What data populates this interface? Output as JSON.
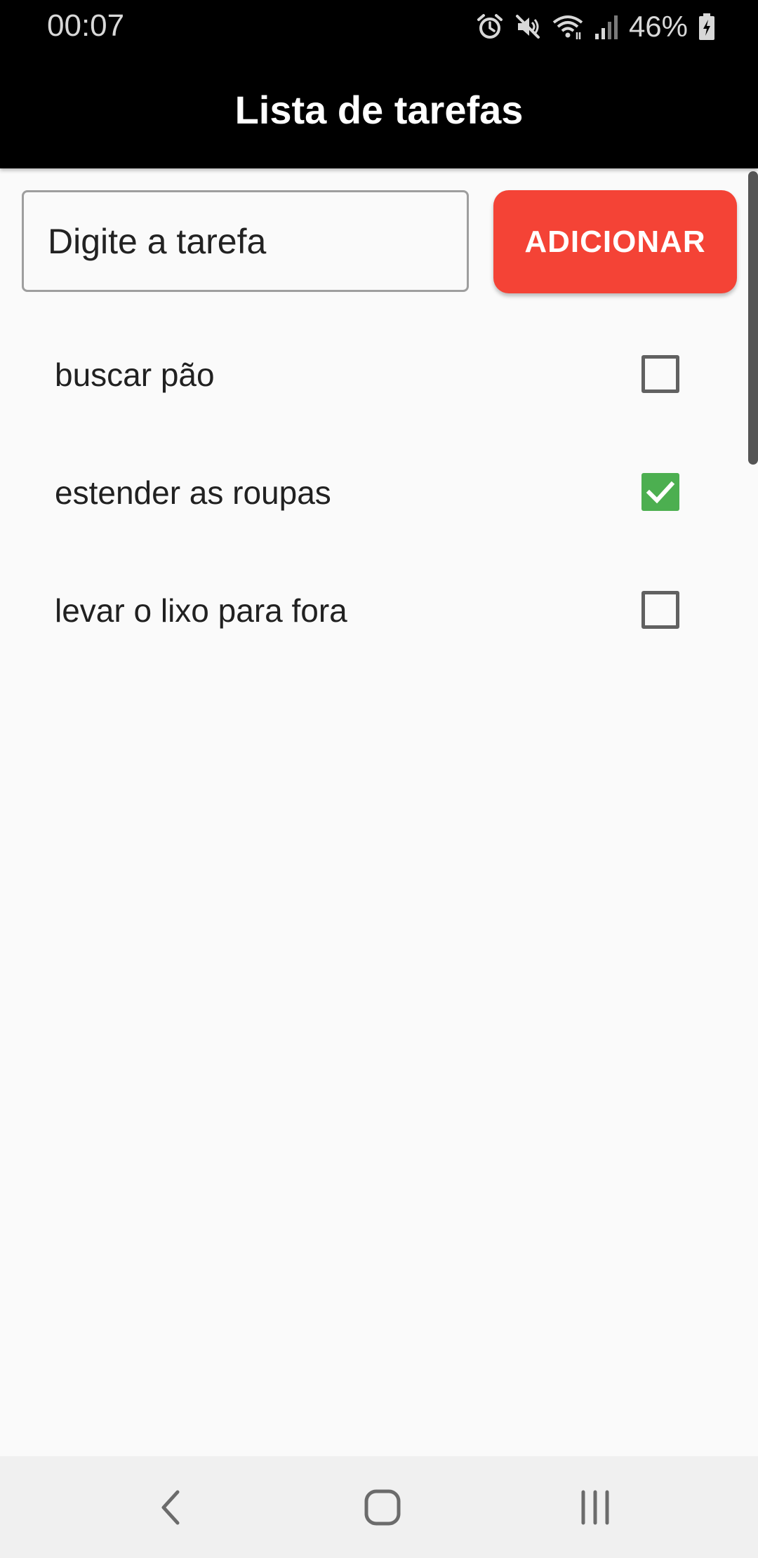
{
  "status_bar": {
    "time": "00:07",
    "battery_percent": "46%",
    "icons": [
      "alarm-icon",
      "mute-icon",
      "wifi-icon",
      "signal-icon",
      "battery-charging-icon"
    ]
  },
  "app_bar": {
    "title": "Lista de tarefas"
  },
  "task_input": {
    "placeholder": "Digite a tarefa",
    "value": ""
  },
  "add_button": {
    "label": "ADICIONAR",
    "color": "#f44336"
  },
  "tasks": [
    {
      "title": "buscar pão",
      "done": false
    },
    {
      "title": "estender as roupas",
      "done": true
    },
    {
      "title": "levar o lixo para fora",
      "done": false
    }
  ],
  "colors": {
    "app_bar": "#000000",
    "background": "#fafafa",
    "checkbox_checked": "#4caf50",
    "checkbox_unchecked_border": "#616161"
  },
  "nav_bar": {
    "buttons": [
      "back-icon",
      "home-icon",
      "recents-icon"
    ]
  }
}
